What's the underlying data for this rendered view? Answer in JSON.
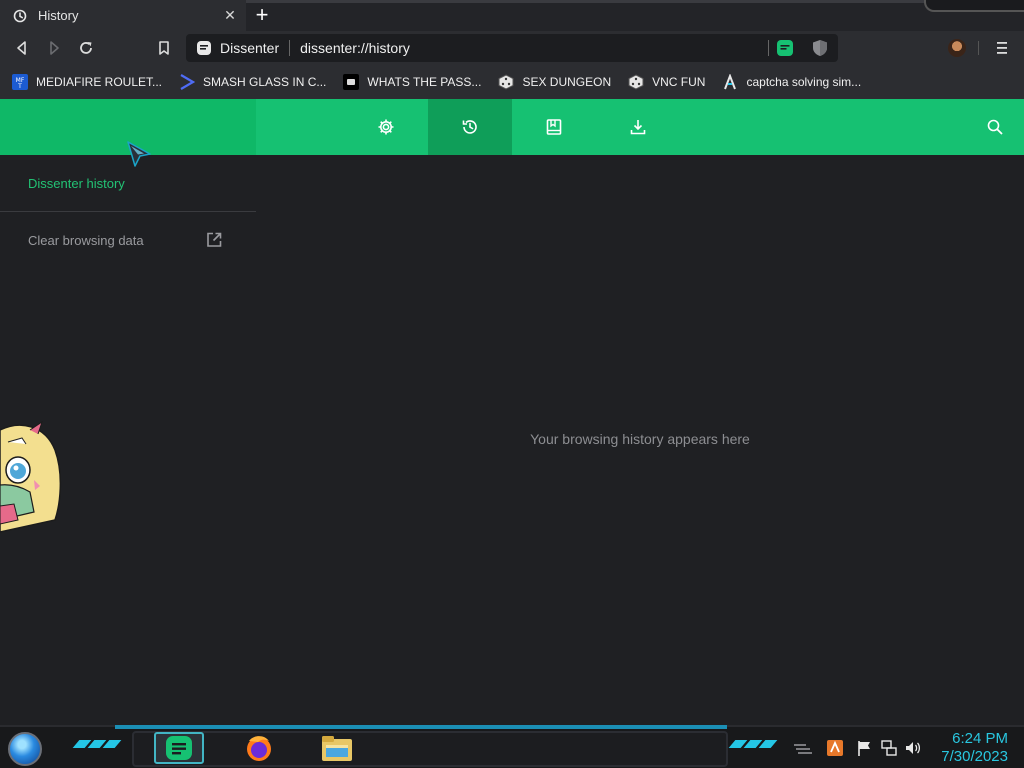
{
  "tab": {
    "title": "History",
    "close": "✕",
    "new_tab": "+"
  },
  "omnibox": {
    "site": "Dissenter",
    "url": "dissenter://history"
  },
  "bookmarks": [
    {
      "label": "MEDIAFIRE ROULET...",
      "icon": "mediafire-icon"
    },
    {
      "label": "SMASH GLASS IN C...",
      "icon": "sigma-icon"
    },
    {
      "label": "WHATS THE PASS...",
      "icon": "chat-icon"
    },
    {
      "label": "SEX DUNGEON",
      "icon": "dice-icon"
    },
    {
      "label": "VNC FUN",
      "icon": "dice-icon"
    },
    {
      "label": "captcha solving sim...",
      "icon": "lambda-icon"
    }
  ],
  "appbar": {
    "tabs": [
      "settings",
      "history",
      "bookmarks",
      "downloads"
    ],
    "active": "history"
  },
  "sidebar": {
    "title": "Dissenter history",
    "clear_label": "Clear browsing data"
  },
  "main": {
    "empty_message": "Your browsing history appears here"
  },
  "taskbar": {
    "time": "6:24 PM",
    "date": "7/30/2023"
  },
  "colors": {
    "accent": "#16c172",
    "background": "#1f2023",
    "clock": "#29c7e0"
  }
}
